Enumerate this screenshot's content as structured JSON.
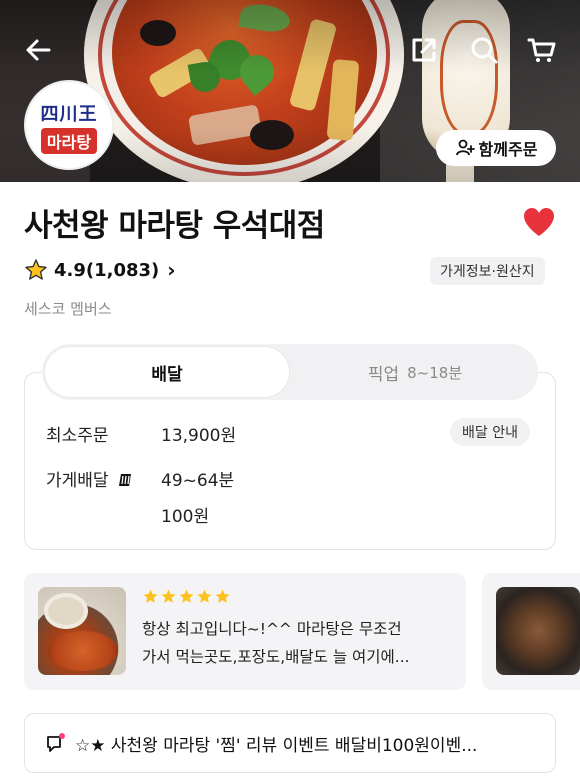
{
  "header": {
    "back_icon": "back-arrow-icon",
    "share_icon": "share-icon",
    "search_icon": "search-icon",
    "cart_icon": "cart-icon"
  },
  "store": {
    "logo_top": "四川王",
    "logo_bottom": "마라탕",
    "together_order_label": "함께주문",
    "name": "사천왕 마라탕 우석대점",
    "rating": "4.9(1,083)",
    "info_label": "가게정보·원산지",
    "membership": "세스코 멤버스",
    "favorite_color": "#e8333c"
  },
  "delivery": {
    "tabs": [
      {
        "label": "배달",
        "sub": ""
      },
      {
        "label": "픽업",
        "sub": "8~18분"
      }
    ],
    "min_order_label": "최소주문",
    "min_order_value": "13,900원",
    "guide_label": "배달 안내",
    "store_delivery_label": "가게배달",
    "delivery_time": "49~64분",
    "delivery_fee": "100원"
  },
  "reviews": [
    {
      "rating": 5,
      "line1": "항상 최고입니다~!^^ 마라탕은 무조건",
      "line2": "가서 먹는곳도,포장도,배달도 늘 여기에..."
    }
  ],
  "notice": {
    "text": "☆★ 사천왕 마라탕 '찜' 리뷰 이벤트 배달비100원이벤..."
  }
}
